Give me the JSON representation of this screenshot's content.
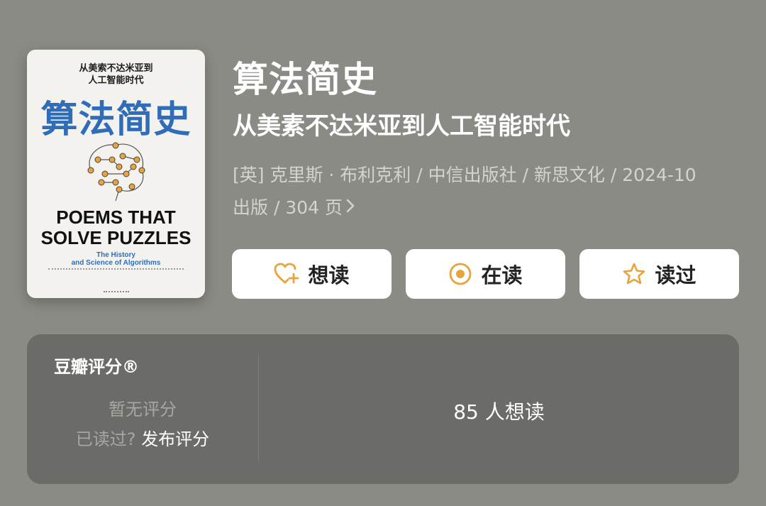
{
  "book": {
    "title": "算法简史",
    "subtitle": "从美素不达米亚到人工智能时代",
    "meta_line1": "[英] 克里斯 · 布利克利 / 中信出版社 / 新思文化 / 2024-10",
    "meta_line2": "出版 / 304 页",
    "cover": {
      "subtitle_line1": "从美索不达米亚到",
      "subtitle_line2": "人工智能时代",
      "title": "算法简史",
      "en_title_line1": "POEMS THAT",
      "en_title_line2": "SOLVE PUZZLES",
      "en_sub_line1": "The History",
      "en_sub_line2": "and Science of Algorithms"
    }
  },
  "actions": {
    "want": "想读",
    "reading": "在读",
    "read": "读过"
  },
  "rating": {
    "label": "豆瓣评分®",
    "no_rating": "暂无评分",
    "read_prompt": "已读过?",
    "publish": "发布评分",
    "want_count": "85 人想读"
  },
  "colors": {
    "background": "#8b8b86",
    "card": "#6b6b67",
    "accent_icon": "#e8a33c",
    "cover_title": "#2f6db8"
  },
  "icons": [
    "heart-plus-icon",
    "target-icon",
    "star-icon",
    "chevron-right-icon",
    "brain-circuit-icon"
  ]
}
